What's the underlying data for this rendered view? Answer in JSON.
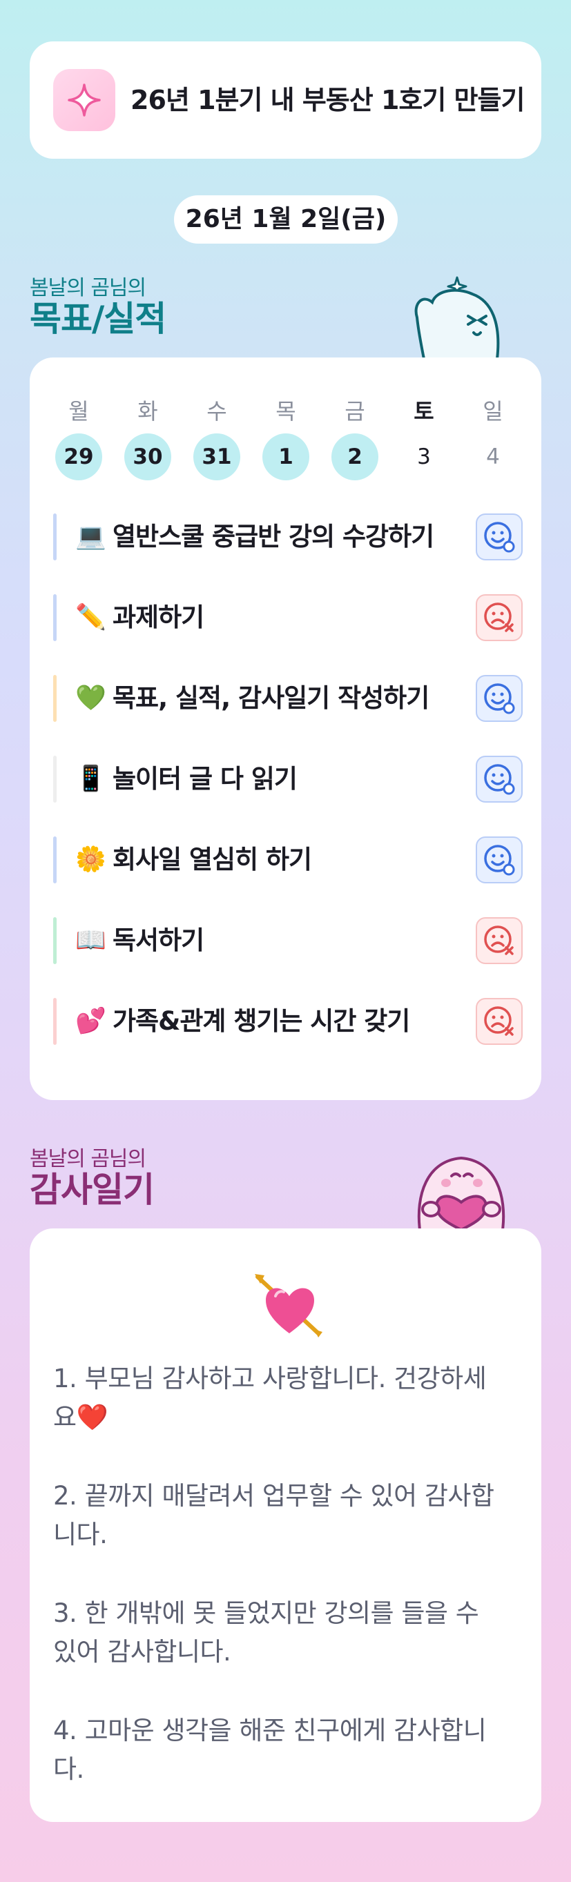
{
  "goal": {
    "title": "26년 1분기 내 부동산 1호기 만들기",
    "icon": "sparkle-icon"
  },
  "date": "26년 1월 2일(금)",
  "goals_section": {
    "small": "봄날의 곰님의",
    "big": "목표/실적"
  },
  "week": [
    {
      "weekday": "월",
      "day": "29",
      "state": "done"
    },
    {
      "weekday": "화",
      "day": "30",
      "state": "done"
    },
    {
      "weekday": "수",
      "day": "31",
      "state": "done"
    },
    {
      "weekday": "목",
      "day": "1",
      "state": "done"
    },
    {
      "weekday": "금",
      "day": "2",
      "state": "done"
    },
    {
      "weekday": "토",
      "day": "3",
      "state": "plain"
    },
    {
      "weekday": "일",
      "day": "4",
      "state": "muted"
    }
  ],
  "tasks": [
    {
      "emoji": "💻",
      "text": "열반스쿨 중급반 강의 수강하기",
      "status": "achieved",
      "bar_color": "#c6d6f7"
    },
    {
      "emoji": "✏️",
      "text": "과제하기",
      "status": "not-achieved",
      "bar_color": "#c6d6f7"
    },
    {
      "emoji": "💚",
      "text": "목표, 실적, 감사일기 작성하기",
      "status": "achieved",
      "bar_color": "#fde0b3"
    },
    {
      "emoji": "📱",
      "text": "놀이터 글 다 읽기",
      "status": "achieved",
      "bar_color": "#eeeeee"
    },
    {
      "emoji": "🌼",
      "text": "회사일 열심히 하기",
      "status": "achieved",
      "bar_color": "#c6d6f7"
    },
    {
      "emoji": "📖",
      "text": "독서하기",
      "status": "not-achieved",
      "bar_color": "#bfeed4"
    },
    {
      "emoji": "💕",
      "text": "가족&관계 챙기는 시간 갖기",
      "status": "not-achieved",
      "bar_color": "#fbd0d0"
    }
  ],
  "thanks_section": {
    "small": "봄날의 곰님의",
    "big": "감사일기"
  },
  "diary": [
    {
      "line1": "1. 부모님 감사하고 사랑합니다. 건강하세",
      "line2": "요❤️"
    },
    {
      "line1": "2. 끝까지 매달려서 업무할 수 있어 감사합",
      "line2": "니다."
    },
    {
      "line1": "3. 한 개밖에 못 들었지만 강의를 들을 수",
      "line2": "있어 감사합니다."
    },
    {
      "line1": "4. 고마운 생각을 해준 친구에게 감사합니",
      "line2": "다."
    }
  ],
  "colors": {
    "achieved": "#3a6fe0",
    "not_achieved": "#e05050",
    "goals_label": "#0f7f89",
    "thanks_label": "#8a2e74",
    "day_done": "#bfeef2"
  }
}
